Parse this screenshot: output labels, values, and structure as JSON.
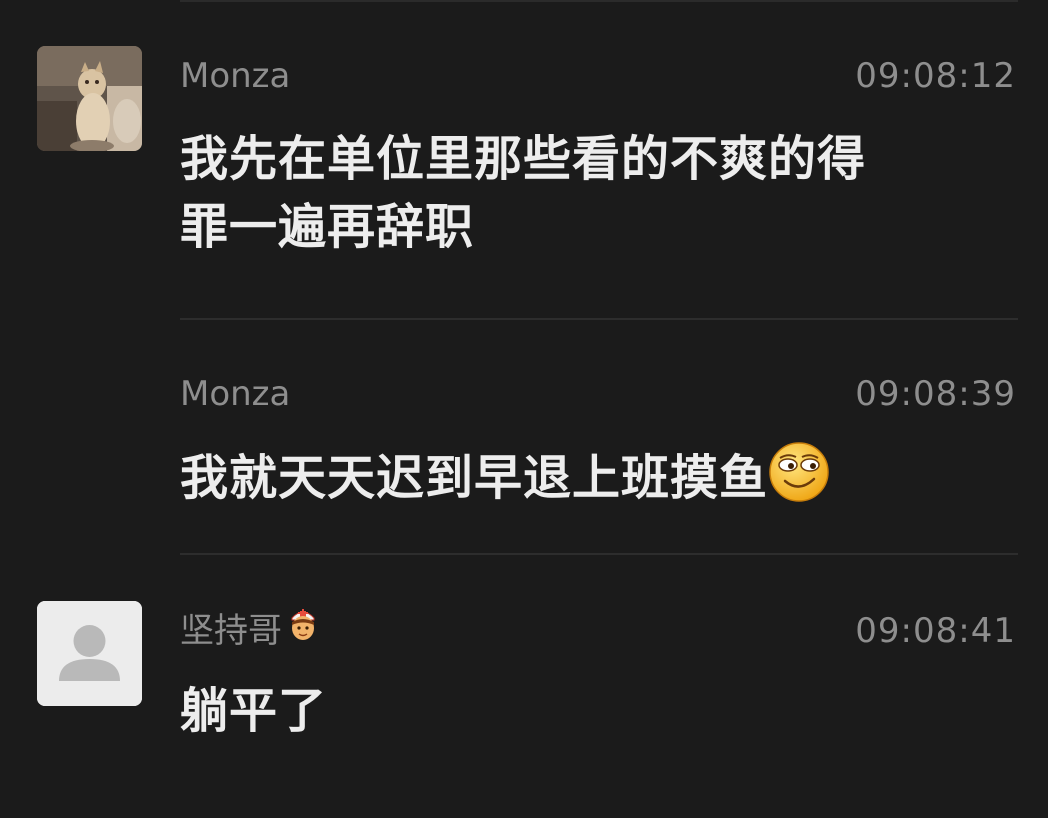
{
  "messages": [
    {
      "sender": "Monza",
      "time": "09:08:12",
      "text_line1": "我先在单位里那些看的不爽的得",
      "text_line2": "罪一遍再辞职",
      "avatar": "cat-photo-avatar"
    },
    {
      "sender": "Monza",
      "time": "09:08:39",
      "text": "我就天天迟到早退上班摸鱼",
      "emoji": "smirk-face-emoji"
    },
    {
      "sender": "坚持哥",
      "sender_badge": "nurse-face-emoji",
      "time": "09:08:41",
      "text": "躺平了",
      "avatar": "default-user-avatar"
    }
  ],
  "colors": {
    "background": "#1b1b1b",
    "text": "#ededed",
    "secondary": "#8e8e8e",
    "divider": "#2d2d2d"
  }
}
